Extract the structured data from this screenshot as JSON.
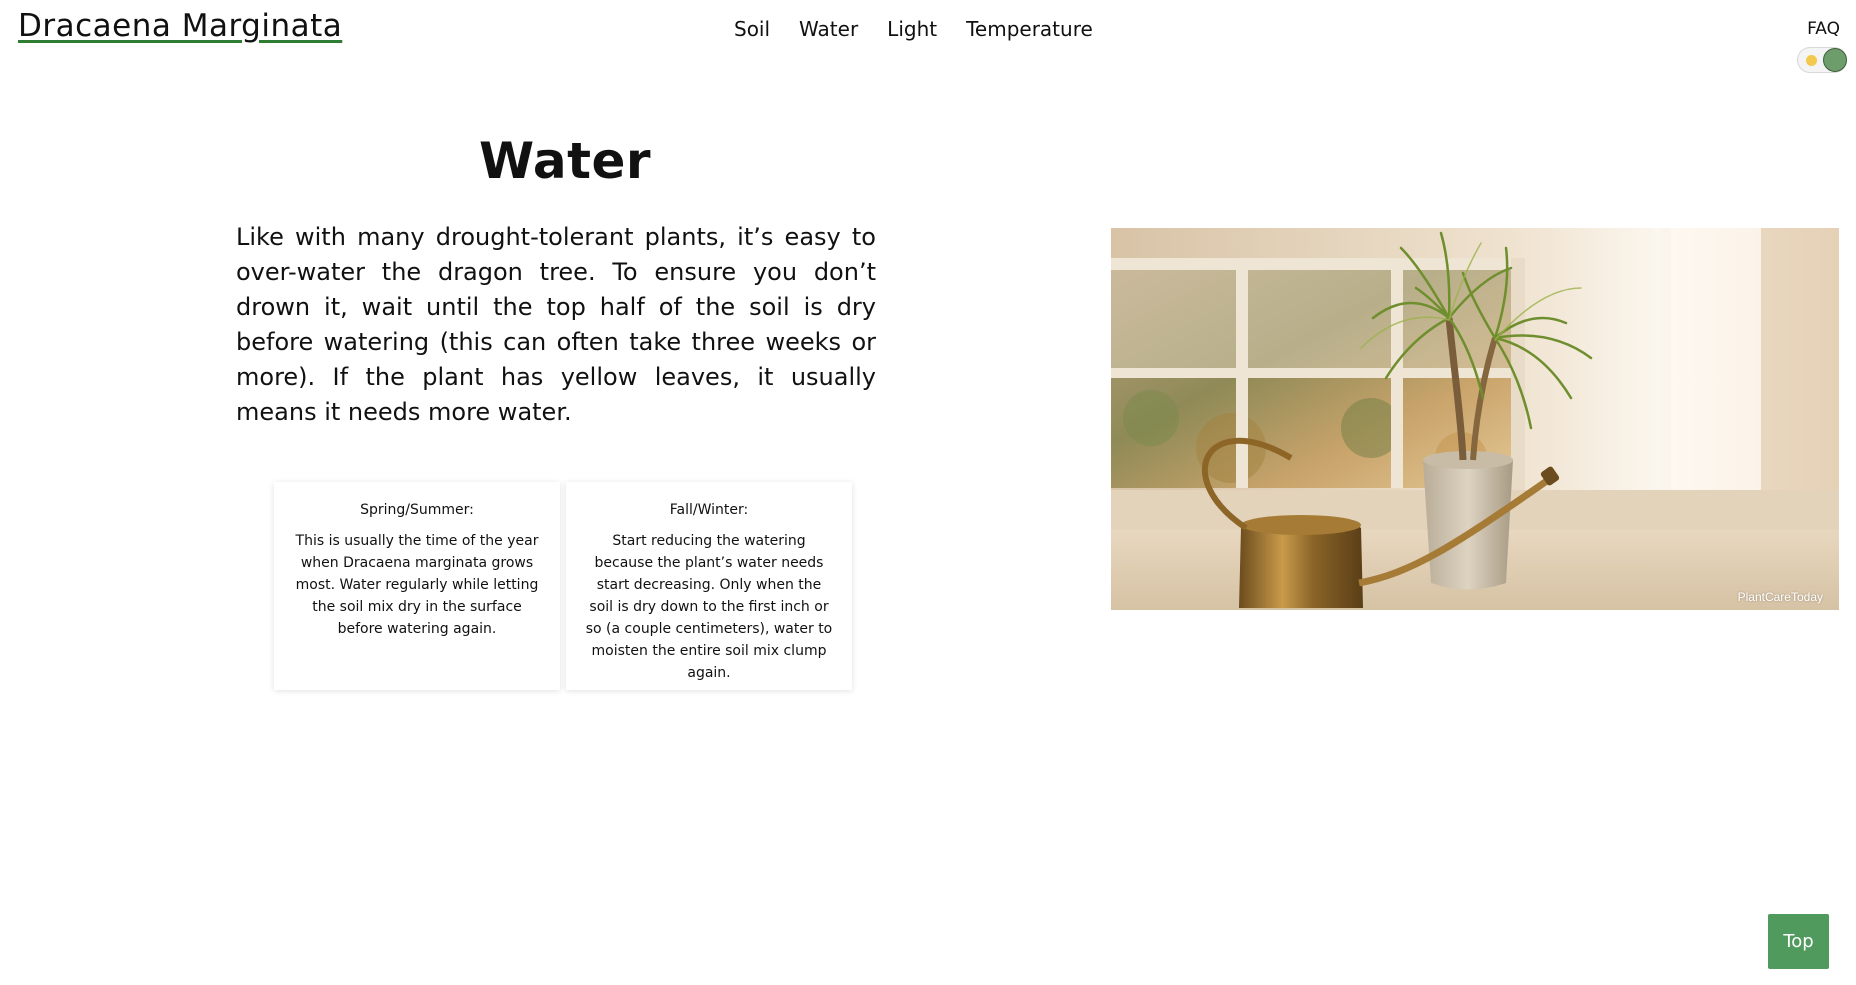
{
  "header": {
    "site_title": "Dracaena Marginata",
    "nav": [
      {
        "label": "Soil"
      },
      {
        "label": "Water"
      },
      {
        "label": "Light"
      },
      {
        "label": "Temperature"
      }
    ],
    "faq_label": "FAQ"
  },
  "theme_toggle": {
    "state": "light",
    "sun_color": "#f2c94c",
    "knob_color": "#6d9d6a"
  },
  "main": {
    "title": "Water",
    "intro": "Like with many drought-tolerant plants, it’s easy to over-water the dragon tree. To ensure you don’t drown it, wait until the top half of the soil is dry before watering (this can often take three weeks or more). If the plant has yellow leaves, it usually means it needs more water.",
    "cards": [
      {
        "title": "Spring/Summer:",
        "text": "This is usually the time of the year when Dracaena marginata grows most. Water regularly while letting the soil mix dry in the surface before watering again."
      },
      {
        "title": "Fall/Winter:",
        "text": "Start reducing the watering because the plant’s water needs start decreasing. Only when the soil is dry down to the first inch or so (a couple centimeters), water to moisten the entire soil mix clump again."
      }
    ],
    "photo": {
      "credit": "PlantCareToday"
    }
  },
  "top_button": {
    "label": "Top",
    "color": "#4f9a5c"
  },
  "accent_color": "#2e7d32"
}
